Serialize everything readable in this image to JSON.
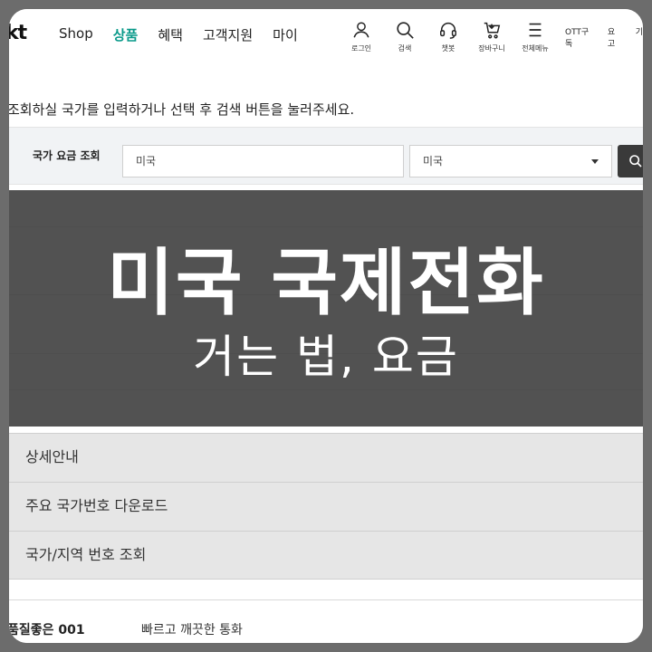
{
  "header": {
    "logo": "kt",
    "nav": [
      "Shop",
      "상품",
      "혜택",
      "고객지원",
      "마이"
    ],
    "active_nav": "상품",
    "icons": [
      {
        "icon": "person-icon",
        "label": "로그인"
      },
      {
        "icon": "search-icon",
        "label": "검색"
      },
      {
        "icon": "headset-icon",
        "label": "챗봇"
      },
      {
        "icon": "cart-icon",
        "label": "장바구니"
      },
      {
        "icon": "menu-icon",
        "label": "전체메뉴"
      }
    ],
    "util_links": [
      "OTT구독",
      "요고",
      "기"
    ]
  },
  "instruction": "조회하실 국가를 입력하거나 선택 후 검색 버튼을 눌러주세요.",
  "search": {
    "label": "국가 요금 조회",
    "input_value": "미국",
    "select_value": "미국"
  },
  "overlay": {
    "title": "미국 국제전화",
    "subtitle": "거는 법, 요금"
  },
  "accordion": [
    "상세안내",
    "주요 국가번호 다운로드",
    "국가/지역 번호 조회"
  ],
  "footer": {
    "left": "품질좋은 001",
    "right": "빠르고 깨끗한 통화"
  },
  "colors": {
    "accent": "#0a9a8a",
    "overlay": "#3a3a3a",
    "frame": "#6c6c6c"
  }
}
